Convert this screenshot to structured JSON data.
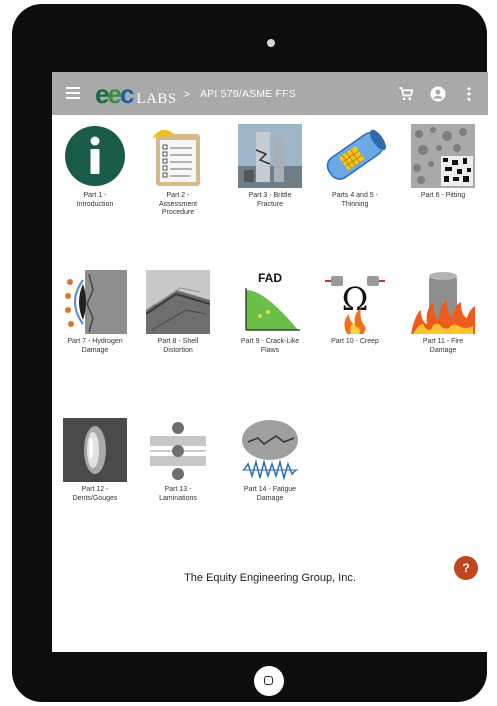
{
  "header": {
    "logo_mark": [
      "e",
      "e",
      "c"
    ],
    "logo_text": "LABS",
    "breadcrumb_separator": ">",
    "breadcrumb": "API 579/ASME FFS",
    "icons": [
      "menu-icon",
      "cart-icon",
      "account-icon",
      "more-vert-icon"
    ]
  },
  "modules": [
    {
      "label": "Part 1 -\nIntroduction"
    },
    {
      "label": "Part 2 -\nAssessment\nProcedure"
    },
    {
      "label": "Part 3 - Brittle\nFracture"
    },
    {
      "label": "Parts 4 and 5 -\nThinning"
    },
    {
      "label": "Part 6 - Pitting"
    },
    {
      "label": "Part 7 - Hydrogen\nDamage"
    },
    {
      "label": "Part 8 - Shell\nDistortion"
    },
    {
      "label": "Part 9 - Crack-Like\nFlaws",
      "thumb_title": "FAD"
    },
    {
      "label": "Part 10 - Creep"
    },
    {
      "label": "Part 11 - Fire\nDamage"
    },
    {
      "label": "Part 12 -\nDents/Gouges"
    },
    {
      "label": "Part 13 -\nLaminations"
    },
    {
      "label": "Part 14 - Fatigue\nDamage"
    }
  ],
  "footer": {
    "company": "The Equity Engineering Group, Inc."
  },
  "help_button": {
    "label": "?"
  },
  "colors": {
    "appbar": "#a9a9a9",
    "brand_green": "#1a6b43",
    "brand_blue": "#1c5fa8",
    "fab": "#c0461f"
  }
}
